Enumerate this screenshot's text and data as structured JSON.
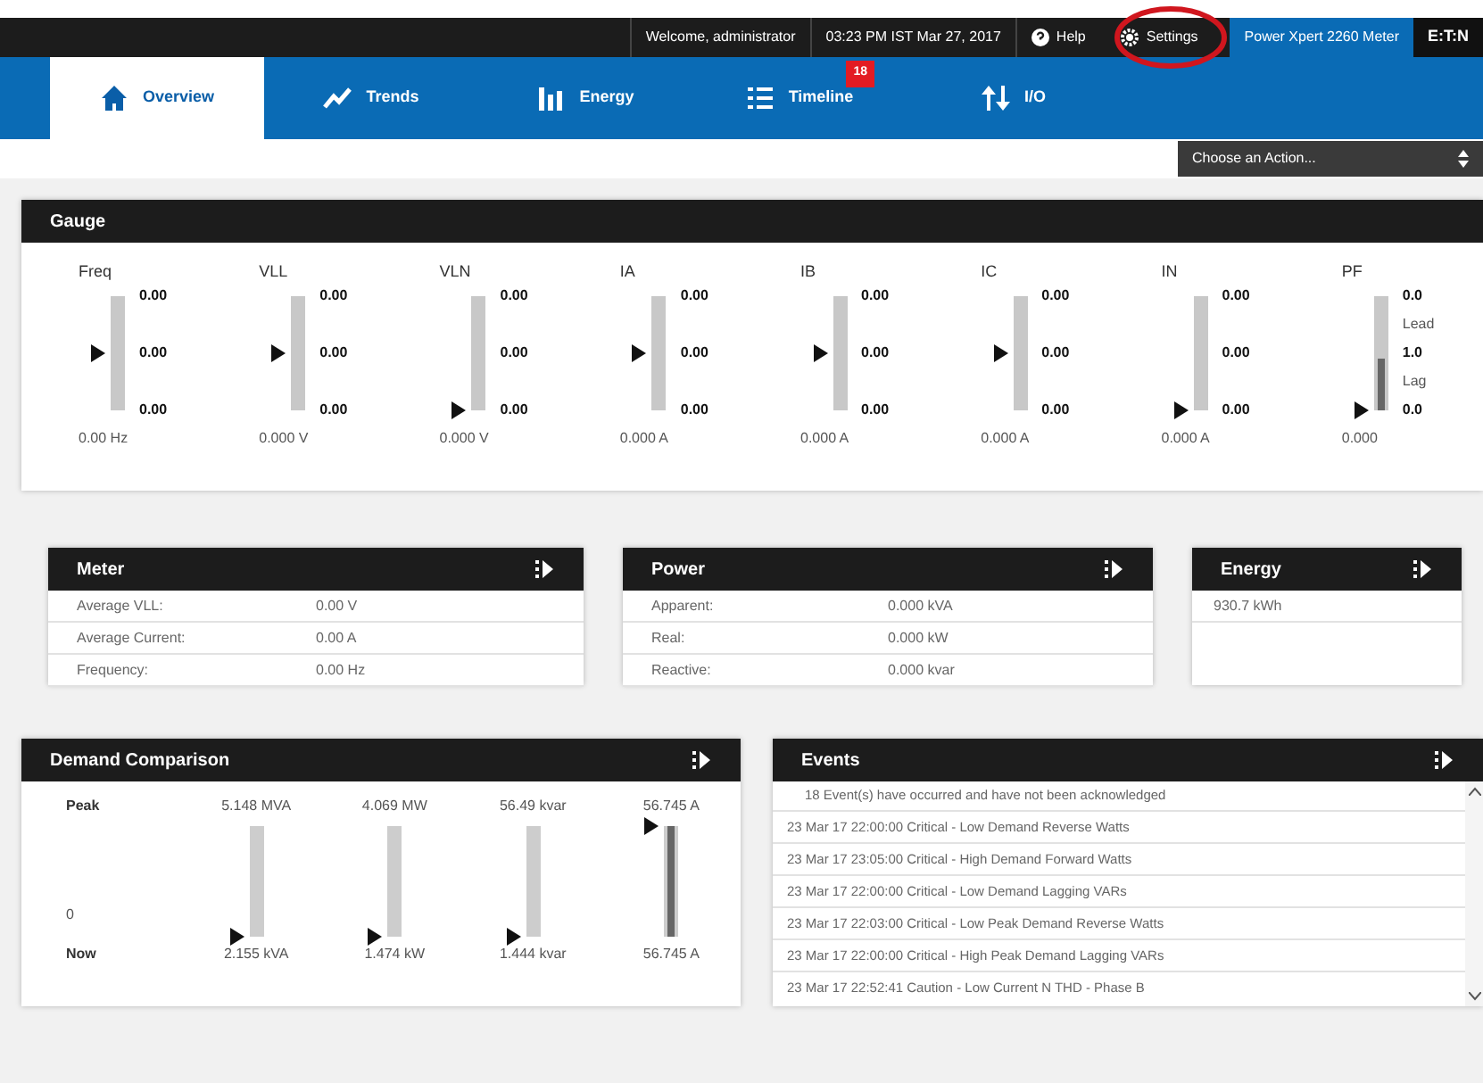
{
  "top_bar": {
    "welcome": "Welcome, administrator",
    "datetime": "03:23 PM IST Mar 27, 2017",
    "help": "Help",
    "settings": "Settings",
    "device": "Power Xpert 2260 Meter",
    "logo": "E:T:N"
  },
  "tabs": [
    {
      "label": "Overview",
      "selected": true
    },
    {
      "label": "Trends",
      "selected": false
    },
    {
      "label": "Energy",
      "selected": false
    },
    {
      "label": "Timeline",
      "selected": false,
      "badge": "18"
    },
    {
      "label": "I/O",
      "selected": false
    }
  ],
  "action_select": {
    "placeholder": "Choose an Action..."
  },
  "gauge_panel": {
    "title": "Gauge",
    "gauges": [
      {
        "kind": "linear",
        "label": "Freq",
        "scale": [
          "0.00",
          "0.00",
          "0.00"
        ],
        "level": 0.5,
        "reading": "0.00 Hz"
      },
      {
        "kind": "linear",
        "label": "VLL",
        "scale": [
          "0.00",
          "0.00",
          "0.00"
        ],
        "level": 0.5,
        "reading": "0.000 V"
      },
      {
        "kind": "linear",
        "label": "VLN",
        "scale": [
          "0.00",
          "0.00",
          "0.00"
        ],
        "level": 0,
        "reading": "0.000 V"
      },
      {
        "kind": "linear",
        "label": "IA",
        "scale": [
          "0.00",
          "0.00",
          "0.00"
        ],
        "level": 0.5,
        "reading": "0.000 A"
      },
      {
        "kind": "linear",
        "label": "IB",
        "scale": [
          "0.00",
          "0.00",
          "0.00"
        ],
        "level": 0.5,
        "reading": "0.000 A"
      },
      {
        "kind": "linear",
        "label": "IC",
        "scale": [
          "0.00",
          "0.00",
          "0.00"
        ],
        "level": 0.5,
        "reading": "0.000 A"
      },
      {
        "kind": "linear",
        "label": "IN",
        "scale": [
          "0.00",
          "0.00",
          "0.00"
        ],
        "level": 0,
        "reading": "0.000 A"
      },
      {
        "kind": "pf",
        "label": "PF",
        "scale": [
          "0.0",
          "Lead",
          "1.0",
          "Lag",
          "0.0"
        ],
        "level": 0,
        "bar": {
          "level": 0.45
        },
        "reading": "0.000"
      }
    ]
  },
  "meter": {
    "title": "Meter",
    "rows": [
      {
        "label": "Average VLL:",
        "value": "0.00 V"
      },
      {
        "label": "Average Current:",
        "value": "0.00 A"
      },
      {
        "label": "Frequency:",
        "value": "0.00 Hz"
      }
    ]
  },
  "power": {
    "title": "Power",
    "rows": [
      {
        "label": "Apparent:",
        "value": "0.000 kVA"
      },
      {
        "label": "Real:",
        "value": "0.000 kW"
      },
      {
        "label": "Reactive:",
        "value": "0.000 kvar"
      }
    ]
  },
  "energy": {
    "title": "Energy",
    "value": "930.7 kWh"
  },
  "demand": {
    "title": "Demand Comparison",
    "peak_label": "Peak",
    "zero_label": "0",
    "now_label": "Now",
    "columns": [
      {
        "peak": "5.148 MVA",
        "now": "2.155 kVA",
        "level": 0
      },
      {
        "peak": "4.069 MW",
        "now": "1.474 kW",
        "level": 0
      },
      {
        "peak": "56.49 kvar",
        "now": "1.444 kvar",
        "level": 0
      },
      {
        "peak": "56.745 A",
        "now": "56.745 A",
        "level": 1
      }
    ]
  },
  "events": {
    "title": "Events",
    "summary": "18 Event(s) have occurred and have not been acknowledged",
    "items": [
      "23 Mar 17 22:00:00 Critical - Low Demand Reverse Watts",
      "23 Mar 17 23:05:00 Critical - High Demand Forward Watts",
      "23 Mar 17 22:00:00 Critical - Low Demand Lagging VARs",
      "23 Mar 17 22:03:00 Critical - Low Peak Demand Reverse Watts",
      "23 Mar 17 22:00:00 Critical - High Peak Demand Lagging VARs",
      "23 Mar 17 22:52:41 Caution - Low Current N THD - Phase B"
    ]
  }
}
